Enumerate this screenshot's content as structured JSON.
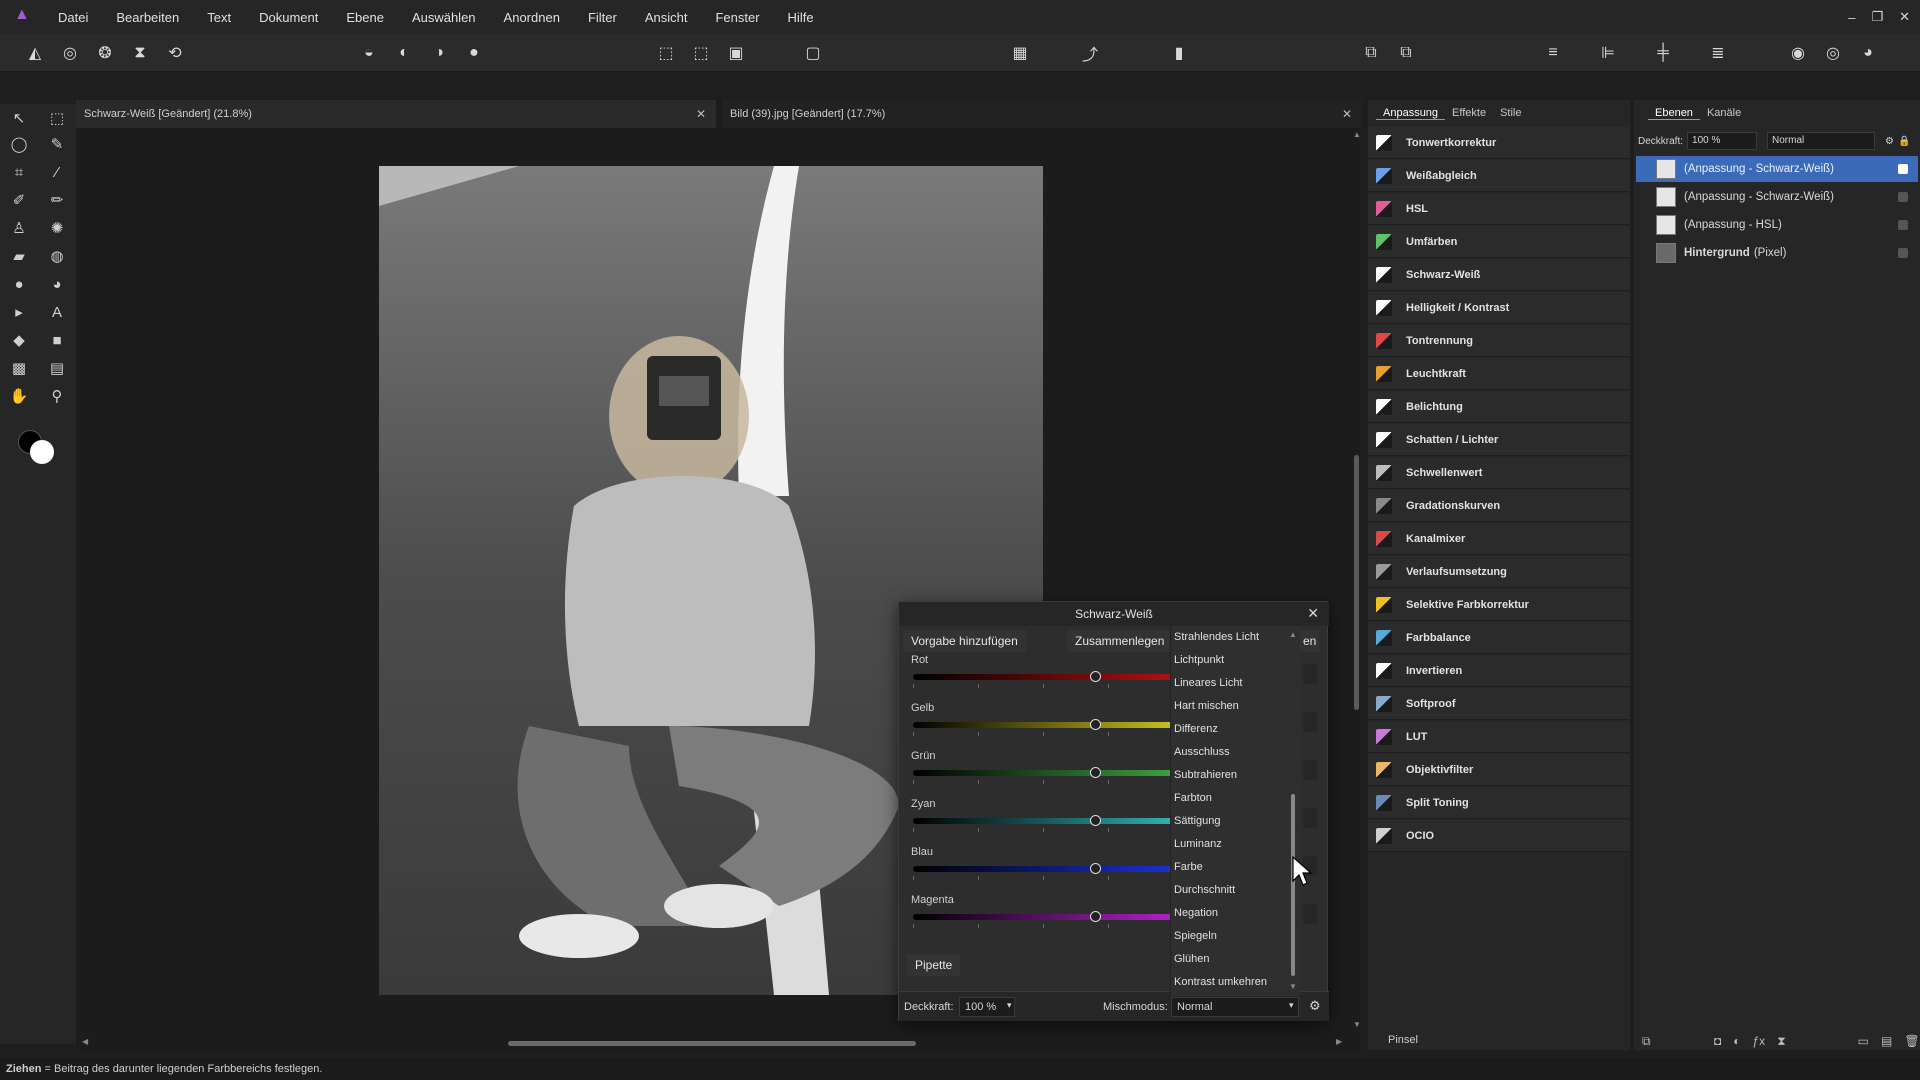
{
  "app": {
    "name": "Affinity Photo"
  },
  "menu": {
    "items": [
      "Datei",
      "Bearbeiten",
      "Text",
      "Dokument",
      "Ebene",
      "Auswählen",
      "Anordnen",
      "Filter",
      "Ansicht",
      "Fenster",
      "Hilfe"
    ]
  },
  "window_controls": {
    "minimize": "–",
    "restore": "❐",
    "close": "✕"
  },
  "documents": {
    "tabs": [
      {
        "label": "Schwarz-Weiß [Geändert] (21.8%)",
        "active": true
      },
      {
        "label": "Bild (39).jpg [Geändert] (17.7%)",
        "active": false
      }
    ]
  },
  "adjustments_panel": {
    "tabs": [
      "Anpassung",
      "Effekte",
      "Stile"
    ],
    "items": [
      {
        "label": "Tonwertkorrektur",
        "color": "#ffffff"
      },
      {
        "label": "Weißabgleich",
        "color": "#6aa0e8"
      },
      {
        "label": "HSL",
        "color": "#e25c9a"
      },
      {
        "label": "Umfärben",
        "color": "#5fc06a"
      },
      {
        "label": "Schwarz-Weiß",
        "color": "#ffffff"
      },
      {
        "label": "Helligkeit / Kontrast",
        "color": "#ffffff"
      },
      {
        "label": "Tontrennung",
        "color": "#e04848"
      },
      {
        "label": "Leuchtkraft",
        "color": "#e8a030"
      },
      {
        "label": "Belichtung",
        "color": "#ffffff"
      },
      {
        "label": "Schatten / Lichter",
        "color": "#ffffff"
      },
      {
        "label": "Schwellenwert",
        "color": "#bdbdbd"
      },
      {
        "label": "Gradationskurven",
        "color": "#8a8a8a"
      },
      {
        "label": "Kanalmixer",
        "color": "#d84a4a"
      },
      {
        "label": "Verlaufsumsetzung",
        "color": "#9a9a9a"
      },
      {
        "label": "Selektive Farbkorrektur",
        "color": "#f0c020"
      },
      {
        "label": "Farbbalance",
        "color": "#58a8d8"
      },
      {
        "label": "Invertieren",
        "color": "#ffffff"
      },
      {
        "label": "Softproof",
        "color": "#8aa8c8"
      },
      {
        "label": "LUT",
        "color": "#c87ad8"
      },
      {
        "label": "Objektivfilter",
        "color": "#e8b868"
      },
      {
        "label": "Split Toning",
        "color": "#6a8ab8"
      },
      {
        "label": "OCIO",
        "color": "#cfcfcf"
      }
    ],
    "footer_label": "Pinsel"
  },
  "layers_panel": {
    "tabs": [
      "Ebenen",
      "Kanäle"
    ],
    "opacity_label": "Deckkraft:",
    "opacity_value": "100 %",
    "blend_mode": "Normal",
    "layers": [
      {
        "name": "(Anpassung - Schwarz-Weiß)",
        "selected": true
      },
      {
        "name": "(Anpassung - Schwarz-Weiß)",
        "selected": false
      },
      {
        "name": "(Anpassung - HSL)",
        "selected": false
      },
      {
        "name": "Hintergrund",
        "suffix": "(Pixel)",
        "selected": false
      }
    ]
  },
  "dialog": {
    "title": "Schwarz-Weiß",
    "add_preset": "Vorgabe hinzufügen",
    "merge": "Zusammenlegen",
    "truncated_button": "en",
    "sliders": [
      {
        "label": "Rot",
        "gradient": [
          "#000000",
          "#b01010"
        ],
        "value": 0.7
      },
      {
        "label": "Gelb",
        "gradient": [
          "#000000",
          "#c8c020"
        ],
        "value": 0.7
      },
      {
        "label": "Grün",
        "gradient": [
          "#000000",
          "#3ca040"
        ],
        "value": 0.7
      },
      {
        "label": "Zyan",
        "gradient": [
          "#000000",
          "#30b0b0"
        ],
        "value": 0.7
      },
      {
        "label": "Blau",
        "gradient": [
          "#000000",
          "#1a30d8"
        ],
        "value": 0.7
      },
      {
        "label": "Magenta",
        "gradient": [
          "#000000",
          "#b020c8"
        ],
        "value": 0.7
      }
    ],
    "pipette": "Pipette",
    "opacity_label": "Deckkraft:",
    "opacity_value": "100 %",
    "blend_label": "Mischmodus:",
    "blend_value": "Normal"
  },
  "blend_dropdown": {
    "items": [
      "Strahlendes Licht",
      "Lichtpunkt",
      "Lineares Licht",
      "Hart mischen",
      "Differenz",
      "Ausschluss",
      "Subtrahieren",
      "Farbton",
      "Sättigung",
      "Luminanz",
      "Farbe",
      "Durchschnitt",
      "Negation",
      "Spiegeln",
      "Glühen",
      "Kontrast umkehren"
    ]
  },
  "status": {
    "key": "Ziehen",
    "text": " = Beitrag des darunter liegenden Farbbereichs festlegen."
  }
}
